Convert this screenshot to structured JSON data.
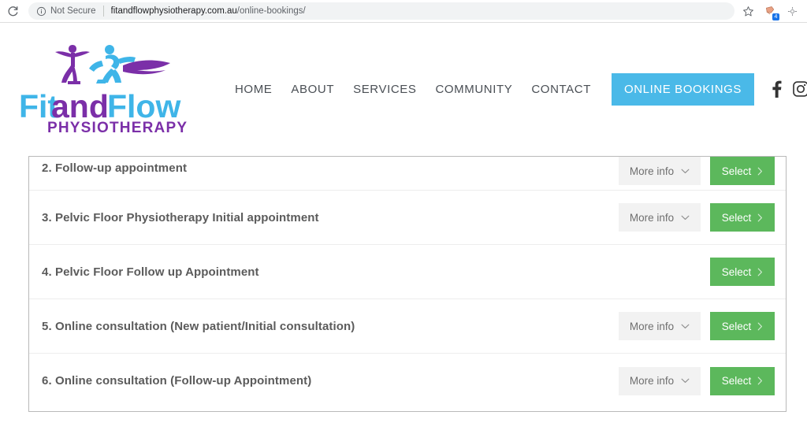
{
  "browser": {
    "reload_icon": "reload-icon",
    "security_icon": "info-circle-icon",
    "security_label": "Not Secure",
    "url_domain": "fitandflowphysiotherapy.com.au",
    "url_path": "/online-bookings/",
    "bookmark_icon": "star-icon",
    "extension_icon": "extension-icon",
    "extension_badge": "4",
    "menu_icon": "more-options-icon"
  },
  "site": {
    "logo": {
      "name": "fitandflow-logo",
      "text_part1": "Fit",
      "text_part2": "and",
      "text_part3": "Flow",
      "subtitle": "PHYSIOTHERAPY",
      "color_blue": "#4ab9e8",
      "color_purple": "#7b2fa8"
    },
    "nav": [
      {
        "label": "HOME",
        "name": "nav-home"
      },
      {
        "label": "ABOUT",
        "name": "nav-about"
      },
      {
        "label": "SERVICES",
        "name": "nav-services"
      },
      {
        "label": "COMMUNITY",
        "name": "nav-community"
      },
      {
        "label": "CONTACT",
        "name": "nav-contact"
      }
    ],
    "cta": {
      "label": "ONLINE BOOKINGS",
      "bg": "#4ab9e8"
    },
    "social": [
      {
        "name": "facebook-icon",
        "label": "Facebook"
      },
      {
        "name": "instagram-icon",
        "label": "Instagram"
      }
    ]
  },
  "booking": {
    "more_info_label": "More info",
    "select_label": "Select",
    "select_color": "#5cb85c",
    "rows": [
      {
        "label": "2. Follow-up appointment",
        "has_more_info": true,
        "clipped": true
      },
      {
        "label": "3. Pelvic Floor Physiotherapy Initial appointment",
        "has_more_info": true,
        "clipped": false
      },
      {
        "label": "4. Pelvic Floor Follow up Appointment",
        "has_more_info": false,
        "clipped": false
      },
      {
        "label": "5. Online consultation (New patient/Initial consultation)",
        "has_more_info": true,
        "clipped": false
      },
      {
        "label": "6. Online consultation (Follow-up Appointment)",
        "has_more_info": true,
        "clipped": false
      }
    ]
  }
}
